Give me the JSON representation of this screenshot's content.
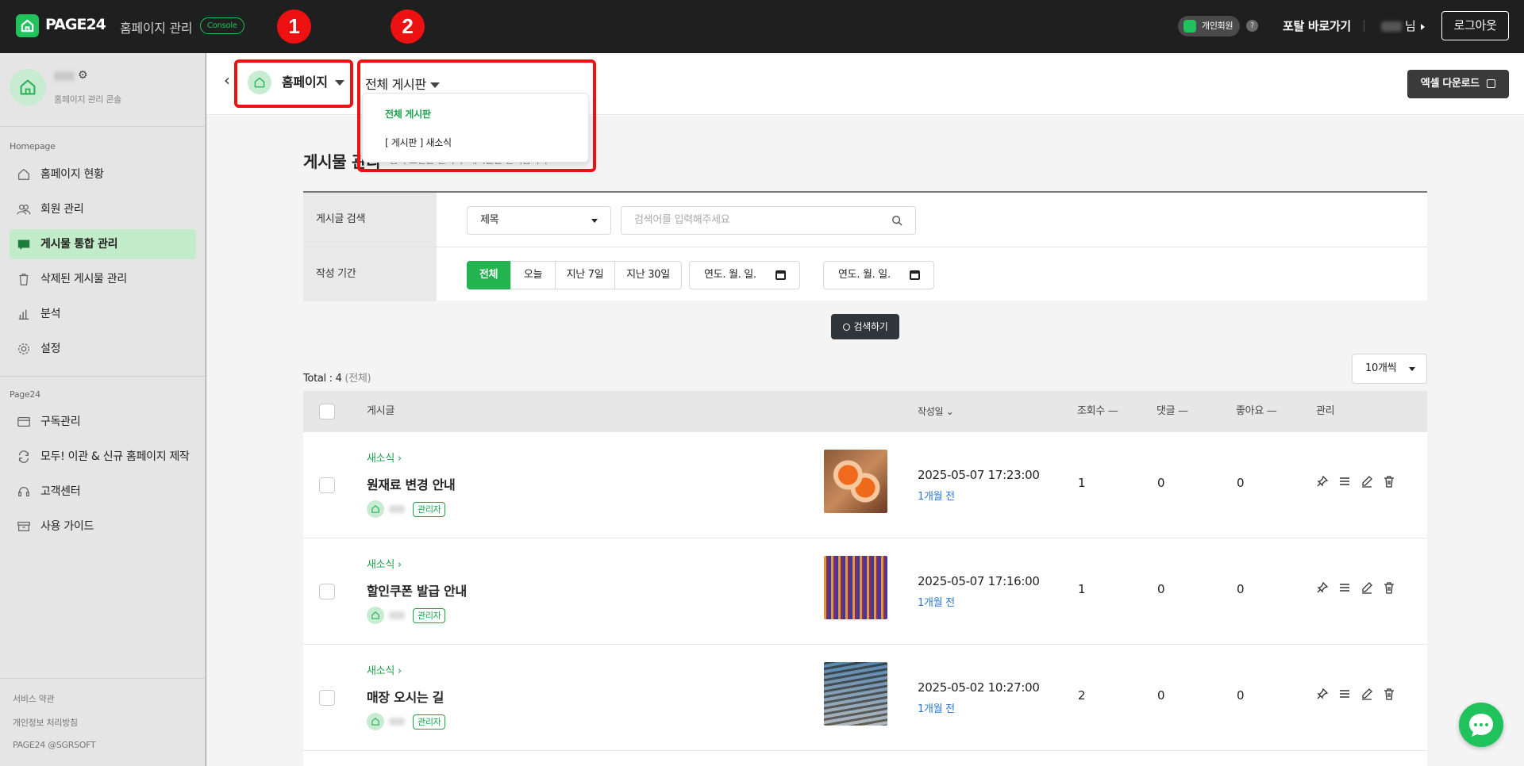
{
  "topbar": {
    "brand": "PAGE24",
    "title": "홈페이지 관리",
    "console_badge": "Console",
    "member_type": "개인회원",
    "help": "?",
    "portal_link": "포탈 바로가기",
    "user_suffix": "님",
    "logout": "로그아웃"
  },
  "annotations": [
    "1",
    "2"
  ],
  "sidebar": {
    "subtitle": "홈페이지 관리 콘솔",
    "section_homepage": "Homepage",
    "items": [
      {
        "label": "홈페이지 현황",
        "icon": "home-icon"
      },
      {
        "label": "회원 관리",
        "icon": "users-icon"
      },
      {
        "label": "게시물 통합 관리",
        "icon": "board-icon"
      },
      {
        "label": "삭제된 게시물 관리",
        "icon": "trash-icon"
      },
      {
        "label": "분석",
        "icon": "chart-icon"
      },
      {
        "label": "설정",
        "icon": "gear-icon"
      }
    ],
    "section_page24": "Page24",
    "items2": [
      {
        "label": "구독관리",
        "icon": "card-icon"
      },
      {
        "label": "모두! 이관 & 신규 홈페이지 제작",
        "icon": "refresh-icon"
      },
      {
        "label": "고객센터",
        "icon": "headset-icon"
      },
      {
        "label": "사용 가이드",
        "icon": "archive-icon"
      }
    ],
    "footer": [
      "서비스 약관",
      "개인정보 처리방침",
      "PAGE24 @SGRSOFT"
    ]
  },
  "header": {
    "site_selector": "홈페이지",
    "board_selector": "전체 게시판",
    "board_options": [
      "전체 게시판",
      "[ 게시판 ] 새소식"
    ],
    "excel_button": "엑셀 다운로드"
  },
  "page": {
    "title": "게시물 관리",
    "description": "검색 조건을 선택 후 게시물을 관리합니다"
  },
  "filter": {
    "search_label": "게시글 검색",
    "search_field": "제목",
    "search_placeholder": "검색어를 입력해주세요",
    "period_label": "작성 기간",
    "periods": [
      "전체",
      "오늘",
      "지난 7일",
      "지난 30일"
    ],
    "date_placeholder": "연도. 월. 일.",
    "tilde": "~",
    "search_button": "검색하기"
  },
  "list": {
    "total_label": "Total : 4",
    "total_sub": "(전체)",
    "per_page": "10개씩",
    "columns": {
      "post": "게시글",
      "date": "작성일",
      "views": "조회수",
      "comments": "댓글",
      "likes": "좋아요",
      "manage": "관리"
    },
    "rows": [
      {
        "category": "새소식",
        "title": "원재료 변경 안내",
        "badge": "관리자",
        "date": "2025-05-07 17:23:00",
        "relative": "1개월 전",
        "views": "1",
        "comments": "0",
        "likes": "0"
      },
      {
        "category": "새소식",
        "title": "할인쿠폰 발급 안내",
        "badge": "관리자",
        "date": "2025-05-07 17:16:00",
        "relative": "1개월 전",
        "views": "1",
        "comments": "0",
        "likes": "0"
      },
      {
        "category": "새소식",
        "title": "매장 오시는 길",
        "badge": "관리자",
        "date": "2025-05-02 10:27:00",
        "relative": "1개월 전",
        "views": "2",
        "comments": "0",
        "likes": "0"
      }
    ]
  },
  "colors": {
    "brand_green": "#1fc25b",
    "annotation_red": "#ee1111",
    "link_blue": "#2a78d6"
  }
}
